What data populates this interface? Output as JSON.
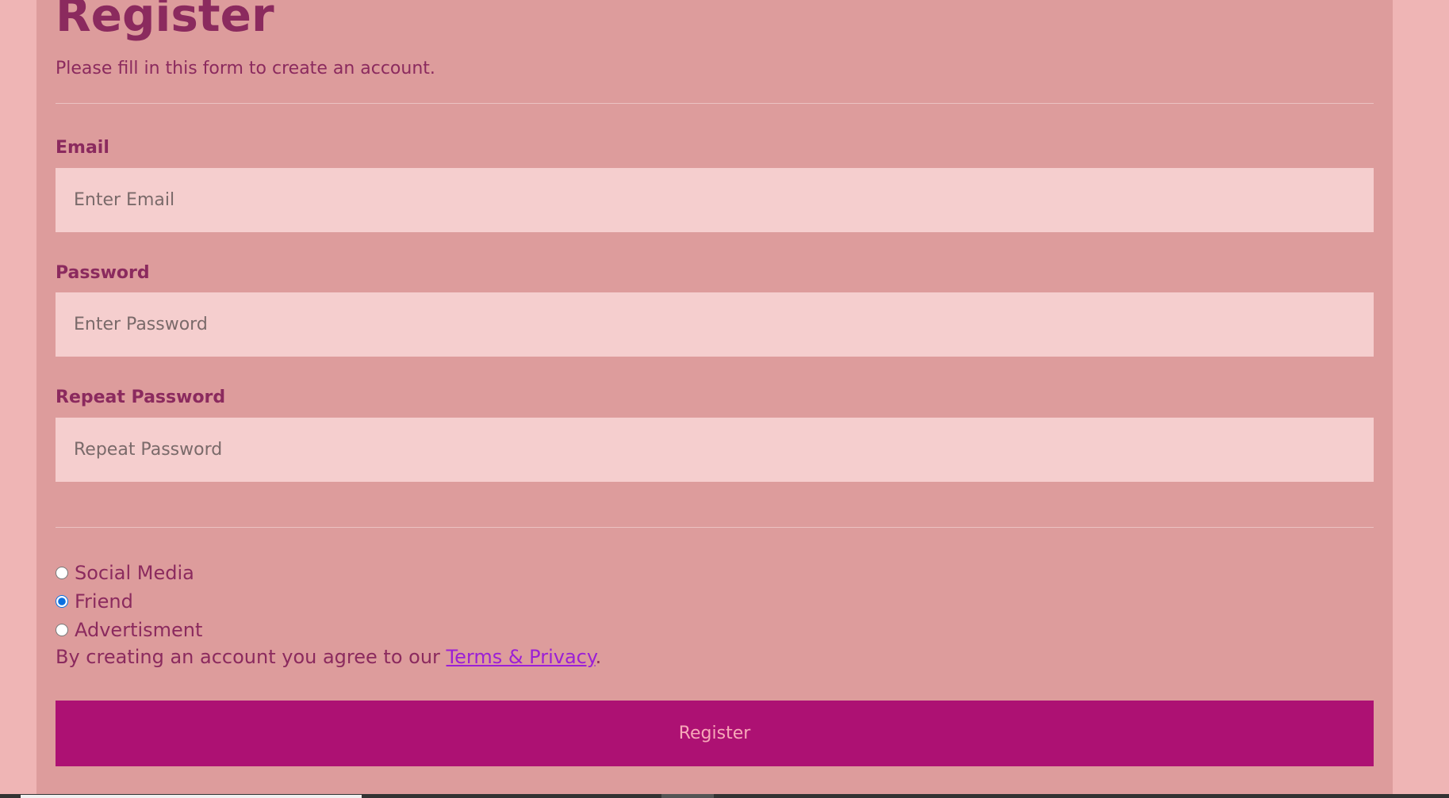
{
  "form": {
    "title": "Register",
    "subtitle": "Please fill in this form to create an account.",
    "email": {
      "label": "Email",
      "placeholder": "Enter Email"
    },
    "password": {
      "label": "Password",
      "placeholder": "Enter Password"
    },
    "repeat_password": {
      "label": "Repeat Password",
      "placeholder": "Repeat Password"
    },
    "referral_options": [
      {
        "label": "Social Media",
        "checked": false
      },
      {
        "label": "Friend",
        "checked": true
      },
      {
        "label": "Advertisment",
        "checked": false
      }
    ],
    "terms_prefix": "By creating an account you agree to our ",
    "terms_link": "Terms & Privacy",
    "terms_suffix": ".",
    "register_button": "Register"
  },
  "colors": {
    "page_background": "#efb5b5",
    "container_background": "#dd9c9c",
    "input_background": "#f5cece",
    "text": "#8b2a5e",
    "button_background": "#ad1173",
    "button_text": "#f7a8b8",
    "link": "#9b1fd6"
  }
}
